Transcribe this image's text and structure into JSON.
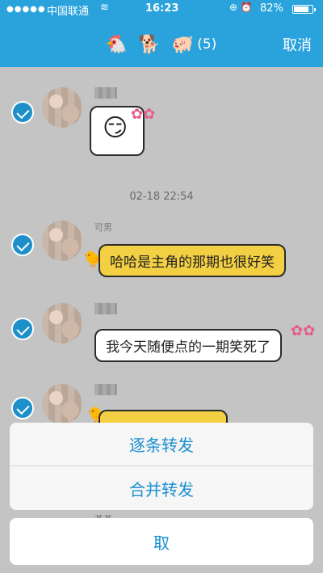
{
  "status_bar": {
    "signal": "●●●●●",
    "carrier": "中国联通",
    "wifi_icon": "wifi-icon",
    "time": "16:23",
    "indicators": "⊕ ⏰",
    "battery_pct": "82%",
    "battery_level": 0.82
  },
  "nav": {
    "icons": [
      "🐔",
      "🐕",
      "🐖"
    ],
    "count": "(5)",
    "cancel": "取消"
  },
  "chat": {
    "timestamp": "02-18 22:54",
    "messages": [
      {
        "name": "",
        "type": "sticker"
      },
      {
        "name": "可男",
        "text": "哈哈是主角的那期也很好笑"
      },
      {
        "name": "",
        "text": "我今天随便点的一期笑死了"
      },
      {
        "name": "",
        "type": "partial"
      }
    ]
  },
  "action_sheet": {
    "option_1": "逐条转发",
    "option_2": "合并转发",
    "cancel": "取",
    "behind_name": "茶茶"
  }
}
